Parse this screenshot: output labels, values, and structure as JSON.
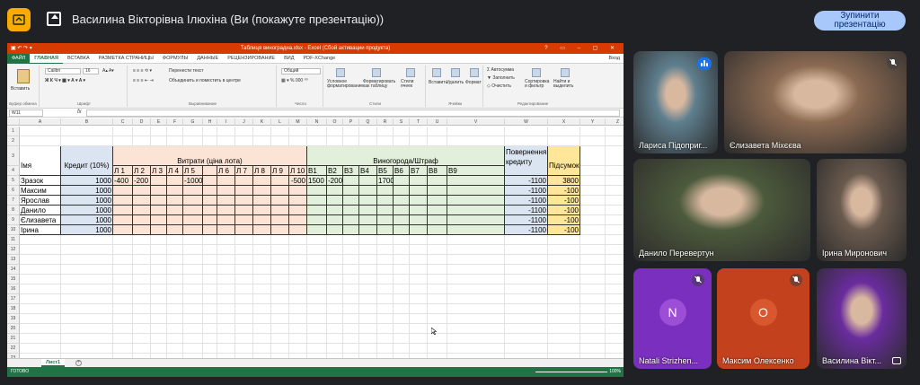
{
  "meet": {
    "presenter_title": "Василина Вікторівна Ілюхіна (Ви (покажуте презентацію))",
    "stop_button": [
      "Зупинити",
      "презентацію"
    ],
    "accent": "#a8c7fa"
  },
  "excel": {
    "titlebar": "Таблиця виноградна.xlsx - Excel (Сбой активации продукта)",
    "tabs": [
      "ФАЙЛ",
      "ГЛАВНАЯ",
      "ВСТАВКА",
      "РАЗМЕТКА СТРАНИЦЫ",
      "ФОРМУЛЫ",
      "ДАННЫЕ",
      "РЕЦЕНЗИРОВАНИЕ",
      "ВИД",
      "PDF-XChange"
    ],
    "login": "Вход",
    "ribbon": {
      "paste": "Вставить",
      "clipboard": "Буфер обмена",
      "font": "Calibri",
      "font_size": "16",
      "font_group": "Шрифт",
      "wrap": "Перенести текст",
      "merge": "Объединить и поместить в центре",
      "alignment": "Выравнивание",
      "number_format": "Общий",
      "number": "Число",
      "cond_format": "Условное форматирование",
      "format_table": "Форматировать как таблицу",
      "cell_styles": "Стили ячеек",
      "styles": "Стили",
      "insert": "Вставить",
      "delete": "Удалить",
      "format": "Формат",
      "cells": "Ячейки",
      "autosum": "Автосумма",
      "fill": "Заполнить",
      "clear": "Очистить",
      "sort": "Сортировка и фильтр",
      "find": "Найти и выделить",
      "editing": "Редактирование"
    },
    "name_box": "W11",
    "fx": "fx",
    "sheet_tab": "Лист1",
    "status": "ГОТОВО",
    "zoom": "100%"
  },
  "sheet": {
    "columns": [
      "A",
      "B",
      "C",
      "D",
      "E",
      "F",
      "G",
      "H",
      "I",
      "J",
      "K",
      "L",
      "M",
      "N",
      "O",
      "P",
      "Q",
      "R",
      "S",
      "T",
      "U",
      "V",
      "W",
      "X",
      "Y",
      "Z"
    ],
    "rows": [
      "1",
      "2",
      "3",
      "4",
      "5",
      "6",
      "7",
      "8",
      "9",
      "10",
      "11",
      "12",
      "13",
      "14",
      "15",
      "16",
      "17",
      "18",
      "19",
      "20",
      "21",
      "22",
      "23",
      "24",
      "25",
      "26",
      "27"
    ],
    "header": {
      "name": "Імя",
      "credit": "Кредит (10%)",
      "costs": "Витрати (ціна лота)",
      "vineyard": "Виногорода/Штраф",
      "return": "Повернення кредиту",
      "total": "Підсумок"
    },
    "lots": [
      "Л 1",
      "Л 2",
      "Л 3",
      "Л 4",
      "Л 5",
      "",
      "Л 6",
      "Л 7",
      "Л 8",
      "Л 9",
      "Л 10"
    ],
    "bs": [
      "B1",
      "B2",
      "B3",
      "B4",
      "B5",
      "B6",
      "B7",
      "B8",
      "B9",
      "B10"
    ],
    "data_rows": [
      {
        "name": "Зразок",
        "credit": "1000",
        "lots": [
          "-400",
          "-200",
          "",
          "",
          "-1000",
          "",
          "",
          "",
          "",
          "",
          "-500"
        ],
        "bs": [
          "1500",
          "-200",
          "",
          "",
          "1700",
          "",
          "",
          "",
          "",
          "3000"
        ],
        "ret": "-1100",
        "total": "3800"
      },
      {
        "name": "Максим",
        "credit": "1000",
        "lots": [
          "",
          "",
          "",
          "",
          "",
          "",
          "",
          "",
          "",
          "",
          ""
        ],
        "bs": [
          "",
          "",
          "",
          "",
          "",
          "",
          "",
          "",
          "",
          ""
        ],
        "ret": "-1100",
        "total": "-100"
      },
      {
        "name": "Ярослав",
        "credit": "1000",
        "lots": [
          "",
          "",
          "",
          "",
          "",
          "",
          "",
          "",
          "",
          "",
          ""
        ],
        "bs": [
          "",
          "",
          "",
          "",
          "",
          "",
          "",
          "",
          "",
          ""
        ],
        "ret": "-1100",
        "total": "-100"
      },
      {
        "name": "Данило",
        "credit": "1000",
        "lots": [
          "",
          "",
          "",
          "",
          "",
          "",
          "",
          "",
          "",
          "",
          ""
        ],
        "bs": [
          "",
          "",
          "",
          "",
          "",
          "",
          "",
          "",
          "",
          ""
        ],
        "ret": "-1100",
        "total": "-100"
      },
      {
        "name": "Єлизавета",
        "credit": "1000",
        "lots": [
          "",
          "",
          "",
          "",
          "",
          "",
          "",
          "",
          "",
          "",
          ""
        ],
        "bs": [
          "",
          "",
          "",
          "",
          "",
          "",
          "",
          "",
          "",
          ""
        ],
        "ret": "-1100",
        "total": "-100"
      },
      {
        "name": "Ірина",
        "credit": "1000",
        "lots": [
          "",
          "",
          "",
          "",
          "",
          "",
          "",
          "",
          "",
          "",
          ""
        ],
        "bs": [
          "",
          "",
          "",
          "",
          "",
          "",
          "",
          "",
          "",
          ""
        ],
        "ret": "-1100",
        "total": "-100"
      }
    ],
    "colors": {
      "credit": "#dbe5f1",
      "costs": "#fbe4d5",
      "vineyard": "#e2efda",
      "return": "#dbe5f1",
      "total": "#ffe699"
    }
  },
  "participants": [
    {
      "name": "Лариса Підоприг...",
      "state": "speaking",
      "bg": "#5f7f8f"
    },
    {
      "name": "Єлизавета Міхєєва",
      "state": "muted",
      "bg": "#8b6a52"
    },
    {
      "name": "Данило Перевертун",
      "state": "none",
      "bg": "#4d5a3c"
    },
    {
      "name": "Ірина Миронович",
      "state": "none",
      "bg": "#6a5a4e"
    },
    {
      "name": "Natali Strizhen...",
      "state": "muted",
      "avatar": "N",
      "bg": "#7b2fbe",
      "avatar_bg": "#9c4fd6"
    },
    {
      "name": "Максим Олексенко",
      "state": "muted",
      "avatar": "O",
      "bg": "#c4411e",
      "avatar_bg": "#d9572f"
    },
    {
      "name": "Василина Вікт...",
      "state": "none",
      "bg": "#6a2c9e"
    }
  ]
}
